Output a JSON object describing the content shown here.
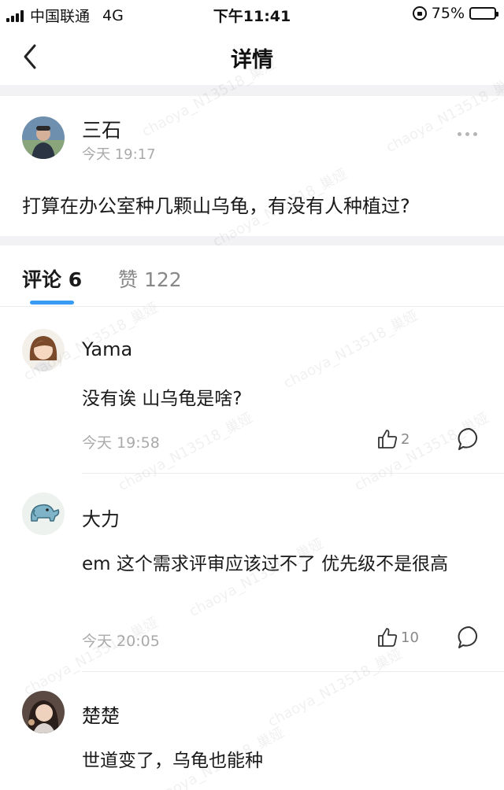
{
  "status_bar": {
    "carrier": "中国联通",
    "network": "4G",
    "time": "下午11:41",
    "battery": "75%",
    "battery_level": 0.75
  },
  "nav": {
    "title": "详情",
    "back_icon": "chevron-left-icon"
  },
  "post": {
    "author": "三石",
    "time": "今天 19:17",
    "content": "打算在办公室种几颗山乌龟，有没有人种植过?",
    "more_icon": "more-dots-icon"
  },
  "tabs": {
    "comments_label": "评论 6",
    "likes_label": "赞 122",
    "accent_color": "#3a9bf5"
  },
  "comments": [
    {
      "author": "Yama",
      "text": "没有诶 山乌龟是啥?",
      "time": "今天 19:58",
      "likes": "2"
    },
    {
      "author": "大力",
      "text": "em 这个需求评审应该过不了 优先级不是很高",
      "time": "今天 20:05",
      "likes": "10"
    },
    {
      "author": "楚楚",
      "text": "世道变了，乌龟也能种"
    }
  ],
  "watermark": "chaoya_N13518_巢娅"
}
